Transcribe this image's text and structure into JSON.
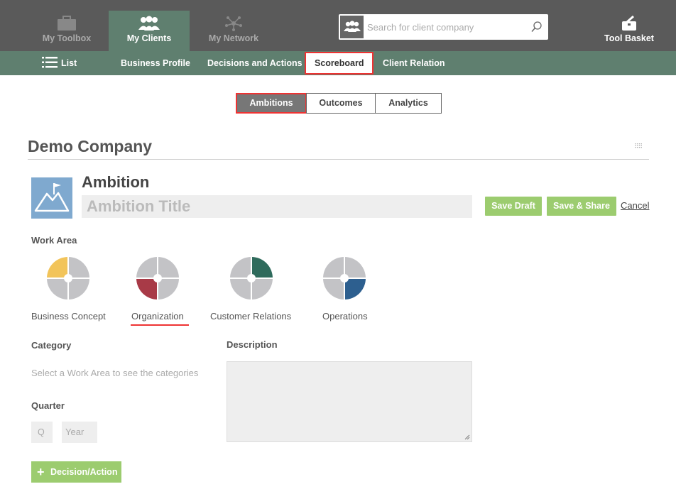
{
  "topnav": {
    "items": [
      {
        "label": "My Toolbox",
        "active": false
      },
      {
        "label": "My Clients",
        "active": true
      },
      {
        "label": "My Network",
        "active": false
      }
    ],
    "search_placeholder": "Search for client company",
    "tool_basket_label": "Tool Basket"
  },
  "subnav": {
    "list_label": "List",
    "items": [
      {
        "label": "Business Profile"
      },
      {
        "label": "Decisions and Actions"
      },
      {
        "label": "Scoreboard",
        "active": true
      },
      {
        "label": "Client Relation"
      }
    ]
  },
  "segment": {
    "tabs": [
      {
        "label": "Ambitions",
        "active": true
      },
      {
        "label": "Outcomes"
      },
      {
        "label": "Analytics"
      }
    ]
  },
  "company_name": "Demo Company",
  "ambition": {
    "heading": "Ambition",
    "title_placeholder": "Ambition Title",
    "save_draft": "Save Draft",
    "save_share": "Save & Share",
    "cancel": "Cancel"
  },
  "work_area": {
    "label": "Work Area",
    "items": [
      {
        "label": "Business Concept",
        "color": "#f2c45a",
        "quadrant": "top-left"
      },
      {
        "label": "Organization",
        "color": "#a83a47",
        "quadrant": "bottom-left",
        "selected": true
      },
      {
        "label": "Customer Relations",
        "color": "#2f6b5c",
        "quadrant": "top-right"
      },
      {
        "label": "Operations",
        "color": "#2d5f8f",
        "quadrant": "bottom-right"
      }
    ]
  },
  "category": {
    "label": "Category",
    "hint": "Select a Work Area to see the categories"
  },
  "description": {
    "label": "Description",
    "value": ""
  },
  "quarter": {
    "label": "Quarter",
    "q_placeholder": "Q",
    "year_placeholder": "Year"
  },
  "decision_action_button": "Decision/Action",
  "colors": {
    "topbar": "#5a5a5a",
    "subbar": "#5f7f6f",
    "green_button": "#9ccc6f",
    "highlight": "#e33333"
  }
}
